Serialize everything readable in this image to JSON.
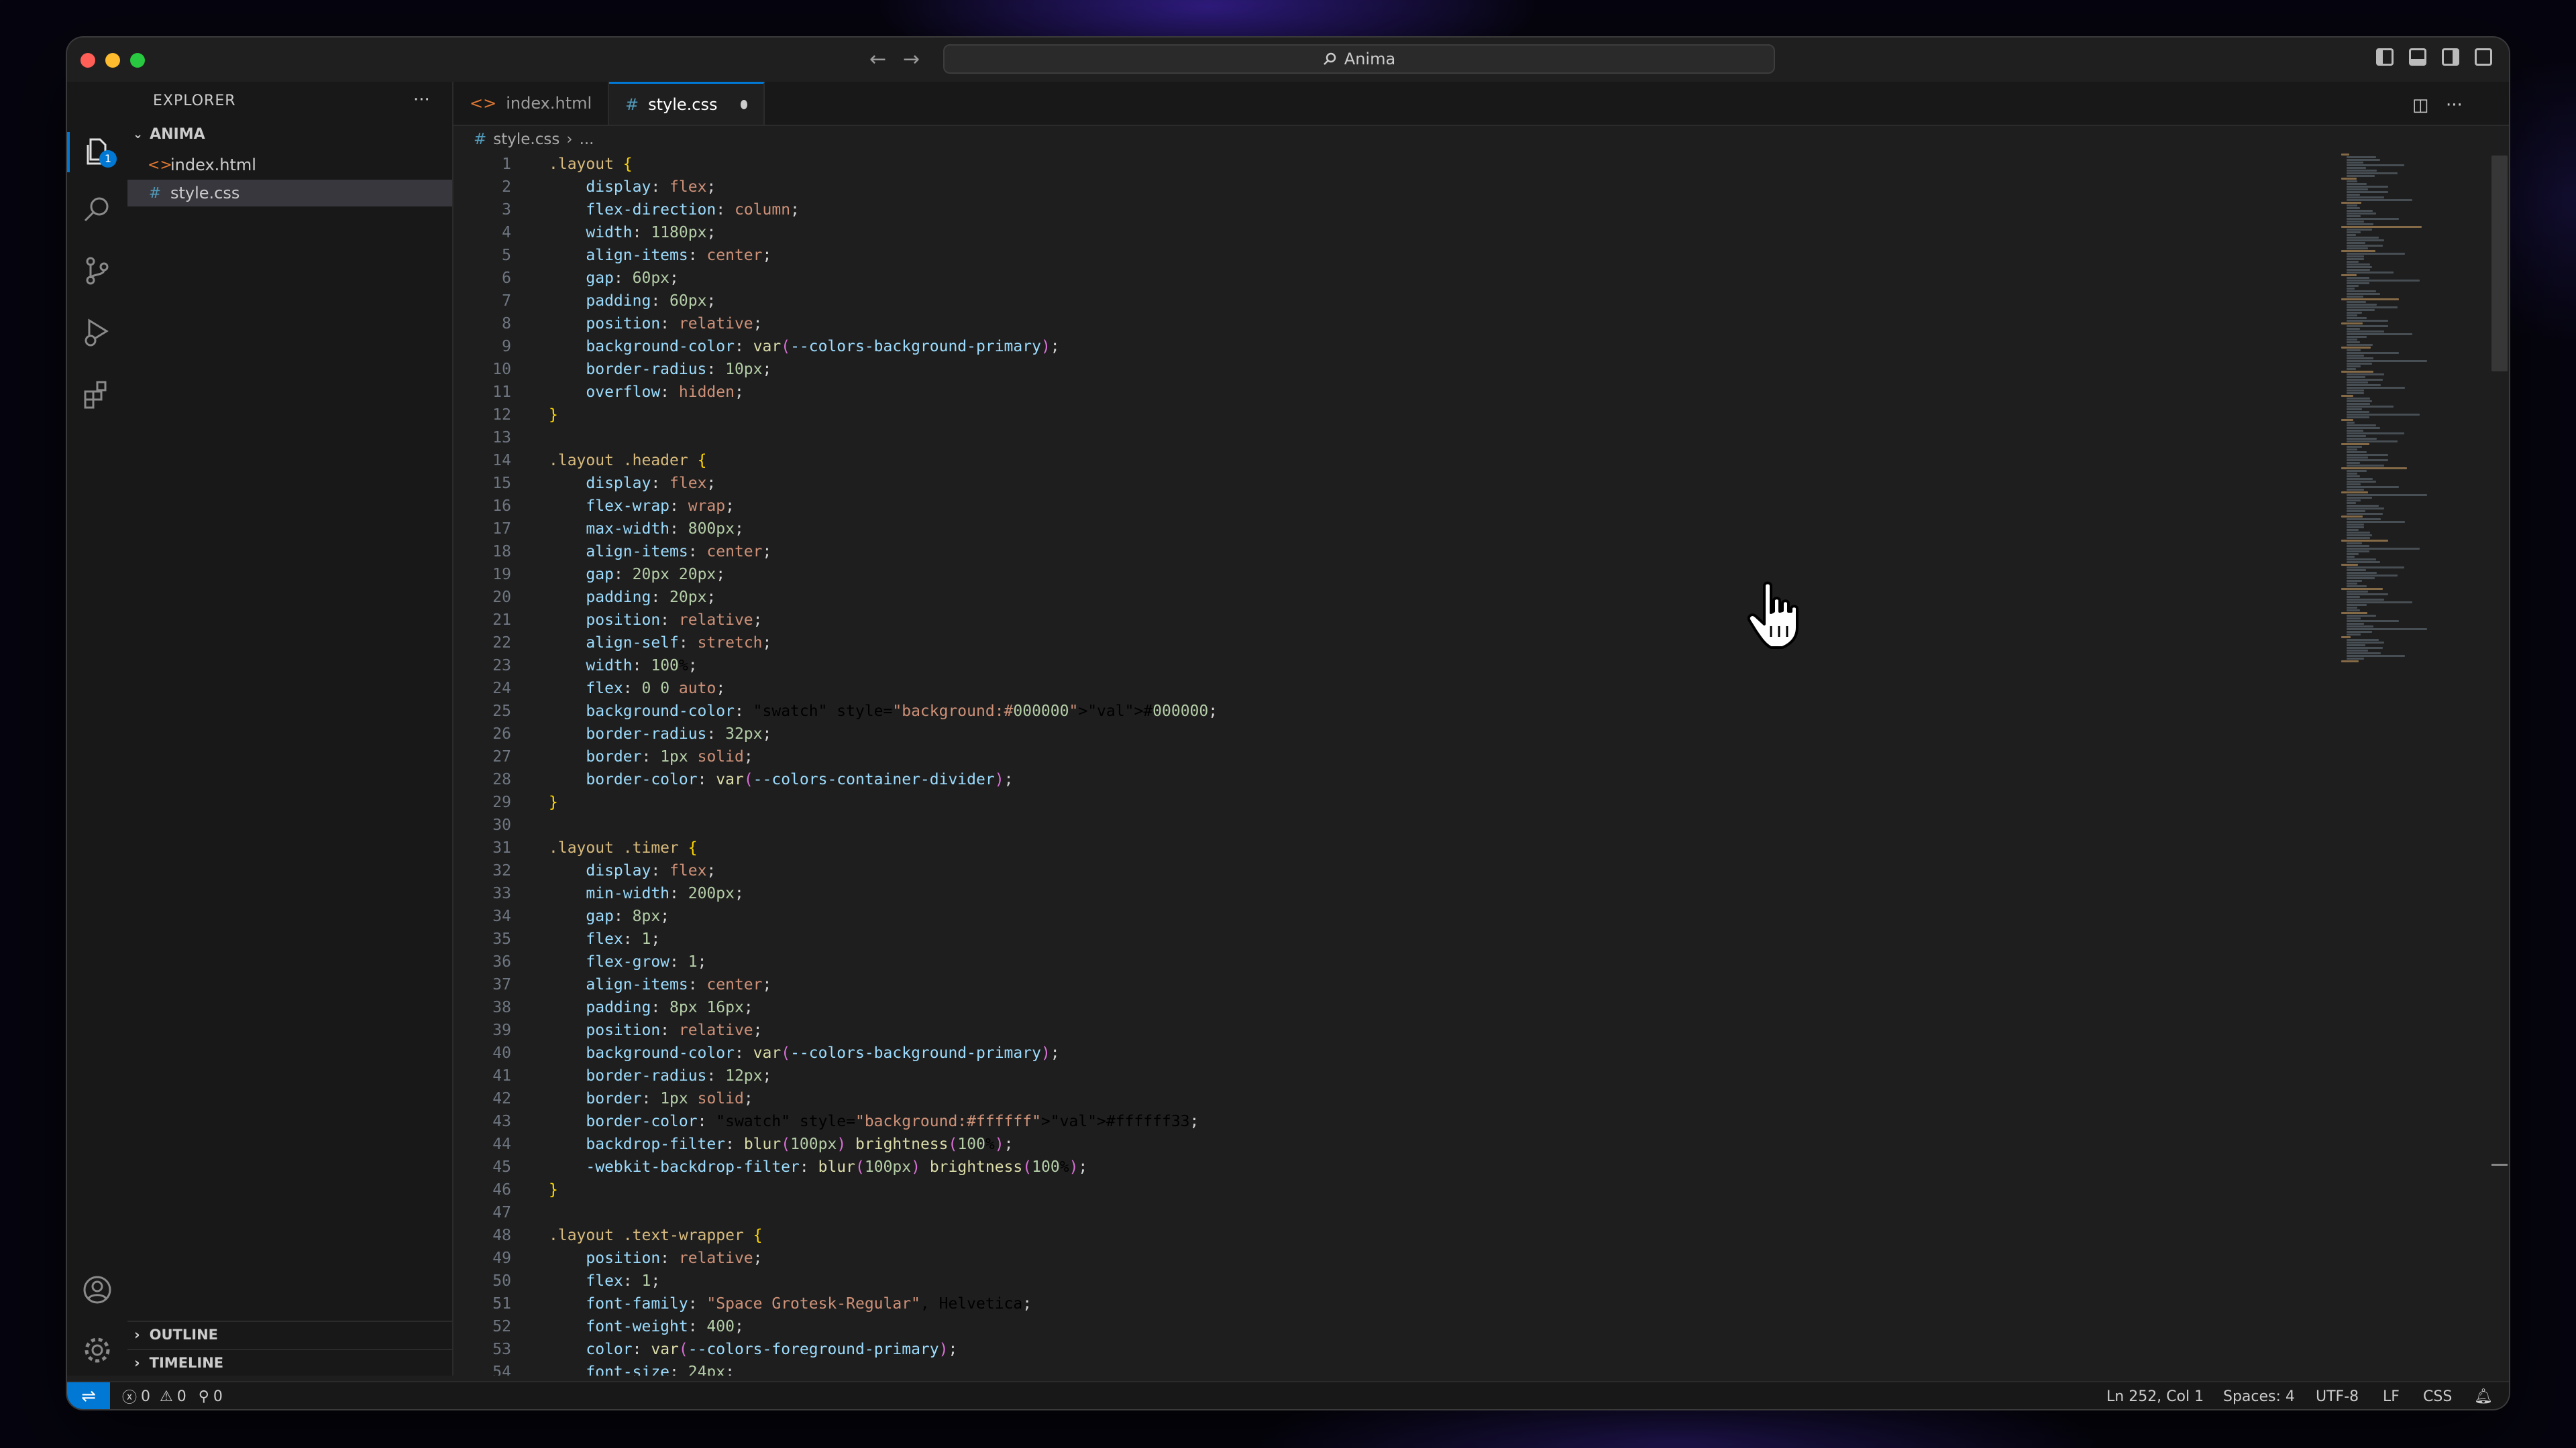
{
  "window": {
    "search_text": "Anima",
    "nav_back": "←",
    "nav_forward": "→"
  },
  "activity_bar": {
    "explorer_badge": "1"
  },
  "sidebar": {
    "title": "EXPLORER",
    "more": "···",
    "folder": "ANIMA",
    "files": [
      {
        "name": "index.html",
        "icon": "<>",
        "active": false
      },
      {
        "name": "style.css",
        "icon": "#",
        "active": true
      }
    ],
    "sections": [
      "OUTLINE",
      "TIMELINE"
    ]
  },
  "tabs": [
    {
      "label": "index.html",
      "icon": "<>"
    },
    {
      "label": "style.css",
      "icon": "#"
    }
  ],
  "breadcrumb": {
    "file": "style.css",
    "rest": "..."
  },
  "code": [
    ".layout {",
    "    display: flex;",
    "    flex-direction: column;",
    "    width: 1180px;",
    "    align-items: center;",
    "    gap: 60px;",
    "    padding: 60px;",
    "    position: relative;",
    "    background-color: var(--colors-background-primary);",
    "    border-radius: 10px;",
    "    overflow: hidden;",
    "}",
    "",
    ".layout .header {",
    "    display: flex;",
    "    flex-wrap: wrap;",
    "    max-width: 800px;",
    "    align-items: center;",
    "    gap: 20px 20px;",
    "    padding: 20px;",
    "    position: relative;",
    "    align-self: stretch;",
    "    width: 100%;",
    "    flex: 0 0 auto;",
    "    background-color: #000000;",
    "    border-radius: 32px;",
    "    border: 1px solid;",
    "    border-color: var(--colors-container-divider);",
    "}",
    "",
    ".layout .timer {",
    "    display: flex;",
    "    min-width: 200px;",
    "    gap: 8px;",
    "    flex: 1;",
    "    flex-grow: 1;",
    "    align-items: center;",
    "    padding: 8px 16px;",
    "    position: relative;",
    "    background-color: var(--colors-background-primary);",
    "    border-radius: 12px;",
    "    border: 1px solid;",
    "    border-color: #ffffff33;",
    "    backdrop-filter: blur(100px) brightness(100%);",
    "    -webkit-backdrop-filter: blur(100px) brightness(100%);",
    "}",
    "",
    ".layout .text-wrapper {",
    "    position: relative;",
    "    flex: 1;",
    "    font-family: \"Space Grotesk-Regular\", Helvetica;",
    "    font-weight: 400;",
    "    color: var(--colors-foreground-primary);",
    "    font-size: 24px;"
  ],
  "status": {
    "errors": "0",
    "warnings": "0",
    "ports": "0",
    "position": "Ln 252, Col 1",
    "spaces": "Spaces: 4",
    "encoding": "UTF-8",
    "eol": "LF",
    "language": "CSS"
  },
  "colors": {
    "accent": "#0078d4",
    "editor_bg": "#1e1e1e",
    "sidebar_bg": "#181818"
  }
}
